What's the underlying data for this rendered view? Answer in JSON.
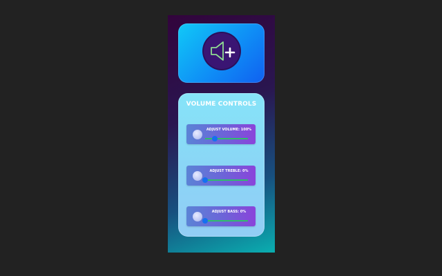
{
  "hero": {
    "icon": "speaker-plus-icon",
    "icon_stroke_color": "#8fdc92",
    "circle_color": "#3a1573"
  },
  "controls": {
    "title": "VOLUME CONTROLS",
    "items": [
      {
        "label": "ADJUST VOLUME: 100%",
        "value_percent": 100,
        "slider_position": 0.22
      },
      {
        "label": "ADJUST TREBLE: 0%",
        "value_percent": 0,
        "slider_position": 0.0
      },
      {
        "label": "ADJUST BASS: 0%",
        "value_percent": 0,
        "slider_position": 0.0
      }
    ]
  },
  "colors": {
    "slider_track": "#2fbe6a",
    "slider_thumb": "#1570f0",
    "page_background": "#222222"
  }
}
